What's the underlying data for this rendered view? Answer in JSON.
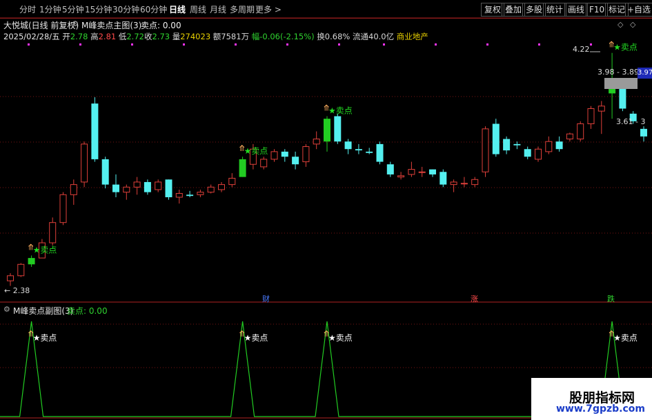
{
  "toolbar": {
    "tabs": [
      "分时",
      "1分钟",
      "5分钟",
      "15分钟",
      "30分钟",
      "60分钟",
      "日线",
      "周线",
      "月线",
      "多周期",
      "更多 >"
    ],
    "right_buttons": [
      "复权",
      "叠加",
      "多股",
      "统计",
      "画线",
      "F10",
      "标记",
      "+自选"
    ]
  },
  "header": {
    "stock": "大悦城(日线 前复权)",
    "indicator": "M峰卖点主图(3)",
    "indicator_value": "卖点: 0.00",
    "date": "2025/02/28/五",
    "open_label": "开",
    "open": "2.78",
    "high_label": "高",
    "high": "2.81",
    "low_label": "低",
    "low": "2.72",
    "close_label": "收",
    "close": "2.73",
    "vol_label": "量",
    "vol": "274023",
    "amount": "额7581万",
    "change": "幅-0.06(-2.15%)",
    "turnover": "换0.68%",
    "float_cap": "流通40.0亿",
    "sector": "商业地产"
  },
  "chart_labels": {
    "sell": "卖点",
    "low_price": "2.38",
    "high_price": "4.22",
    "price_tag_1": "3.98 - 3.89",
    "price_tag_2": "3.61 - 3",
    "right_axis": "3.97",
    "event_cai": "财",
    "event_zhang": "涨",
    "event_die": "跌"
  },
  "sub_pane": {
    "title": "M峰卖点副图(3)",
    "value": "卖点: 0.00"
  },
  "watermark": {
    "line1": "股朋指标网",
    "line2": "www.7gpzb.com"
  },
  "colors": {
    "up": "#e0403a",
    "down": "#54f0f0",
    "signal": "#22cc22",
    "grid": "#7a1414"
  },
  "chart_data": {
    "type": "candlestick",
    "ohlc": [
      [
        2.42,
        2.48,
        2.38,
        2.46
      ],
      [
        2.46,
        2.56,
        2.45,
        2.55
      ],
      [
        2.55,
        2.62,
        2.53,
        2.6
      ],
      [
        2.6,
        2.75,
        2.6,
        2.72
      ],
      [
        2.72,
        2.92,
        2.7,
        2.88
      ],
      [
        2.88,
        3.12,
        2.86,
        3.1
      ],
      [
        3.1,
        3.22,
        3.02,
        3.18
      ],
      [
        3.2,
        3.52,
        3.16,
        3.5
      ],
      [
        3.82,
        3.87,
        3.36,
        3.38
      ],
      [
        3.38,
        3.4,
        3.15,
        3.18
      ],
      [
        3.18,
        3.26,
        3.08,
        3.12
      ],
      [
        3.12,
        3.18,
        3.06,
        3.16
      ],
      [
        3.16,
        3.24,
        3.1,
        3.2
      ],
      [
        3.2,
        3.22,
        3.1,
        3.12
      ],
      [
        3.14,
        3.22,
        3.12,
        3.2
      ],
      [
        3.22,
        3.22,
        3.06,
        3.08
      ],
      [
        3.08,
        3.14,
        3.03,
        3.11
      ],
      [
        3.1,
        3.13,
        3.08,
        3.09
      ],
      [
        3.1,
        3.14,
        3.08,
        3.12
      ],
      [
        3.12,
        3.18,
        3.11,
        3.16
      ],
      [
        3.14,
        3.2,
        3.12,
        3.18
      ],
      [
        3.18,
        3.27,
        3.16,
        3.23
      ],
      [
        3.24,
        3.4,
        3.24,
        3.38
      ],
      [
        3.34,
        3.5,
        3.3,
        3.46
      ],
      [
        3.32,
        3.4,
        3.3,
        3.38
      ],
      [
        3.38,
        3.46,
        3.36,
        3.44
      ],
      [
        3.44,
        3.46,
        3.36,
        3.4
      ],
      [
        3.4,
        3.44,
        3.3,
        3.34
      ],
      [
        3.36,
        3.5,
        3.32,
        3.48
      ],
      [
        3.5,
        3.6,
        3.46,
        3.54
      ],
      [
        3.52,
        3.72,
        3.44,
        3.7
      ],
      [
        3.72,
        3.74,
        3.5,
        3.52
      ],
      [
        3.52,
        3.54,
        3.42,
        3.46
      ],
      [
        3.46,
        3.5,
        3.42,
        3.45
      ],
      [
        3.44,
        3.47,
        3.42,
        3.43
      ],
      [
        3.5,
        3.52,
        3.34,
        3.36
      ],
      [
        3.34,
        3.36,
        3.24,
        3.26
      ],
      [
        3.24,
        3.28,
        3.22,
        3.25
      ],
      [
        3.26,
        3.36,
        3.24,
        3.3
      ],
      [
        3.28,
        3.32,
        3.24,
        3.28
      ],
      [
        3.3,
        3.3,
        3.24,
        3.26
      ],
      [
        3.28,
        3.3,
        3.16,
        3.18
      ],
      [
        3.18,
        3.22,
        3.12,
        3.2
      ],
      [
        3.19,
        3.24,
        3.16,
        3.19
      ],
      [
        3.18,
        3.24,
        3.16,
        3.22
      ],
      [
        3.28,
        3.64,
        3.24,
        3.62
      ],
      [
        3.66,
        3.7,
        3.4,
        3.42
      ],
      [
        3.54,
        3.56,
        3.42,
        3.45
      ],
      [
        3.5,
        3.52,
        3.46,
        3.49
      ],
      [
        3.46,
        3.48,
        3.38,
        3.4
      ],
      [
        3.38,
        3.48,
        3.36,
        3.46
      ],
      [
        3.44,
        3.56,
        3.42,
        3.52
      ],
      [
        3.52,
        3.56,
        3.44,
        3.46
      ],
      [
        3.54,
        3.59,
        3.52,
        3.58
      ],
      [
        3.54,
        3.68,
        3.52,
        3.66
      ],
      [
        3.66,
        3.8,
        3.62,
        3.78
      ],
      [
        3.76,
        3.84,
        3.58,
        3.8
      ],
      [
        3.96,
        4.22,
        3.7,
        3.9
      ],
      [
        3.96,
        3.98,
        3.76,
        3.78
      ],
      [
        3.74,
        3.76,
        3.66,
        3.68
      ],
      [
        3.62,
        3.64,
        3.52,
        3.56
      ]
    ],
    "sell_signals": [
      2,
      22,
      30,
      57
    ],
    "ylim": [
      2.35,
      4.3
    ]
  }
}
